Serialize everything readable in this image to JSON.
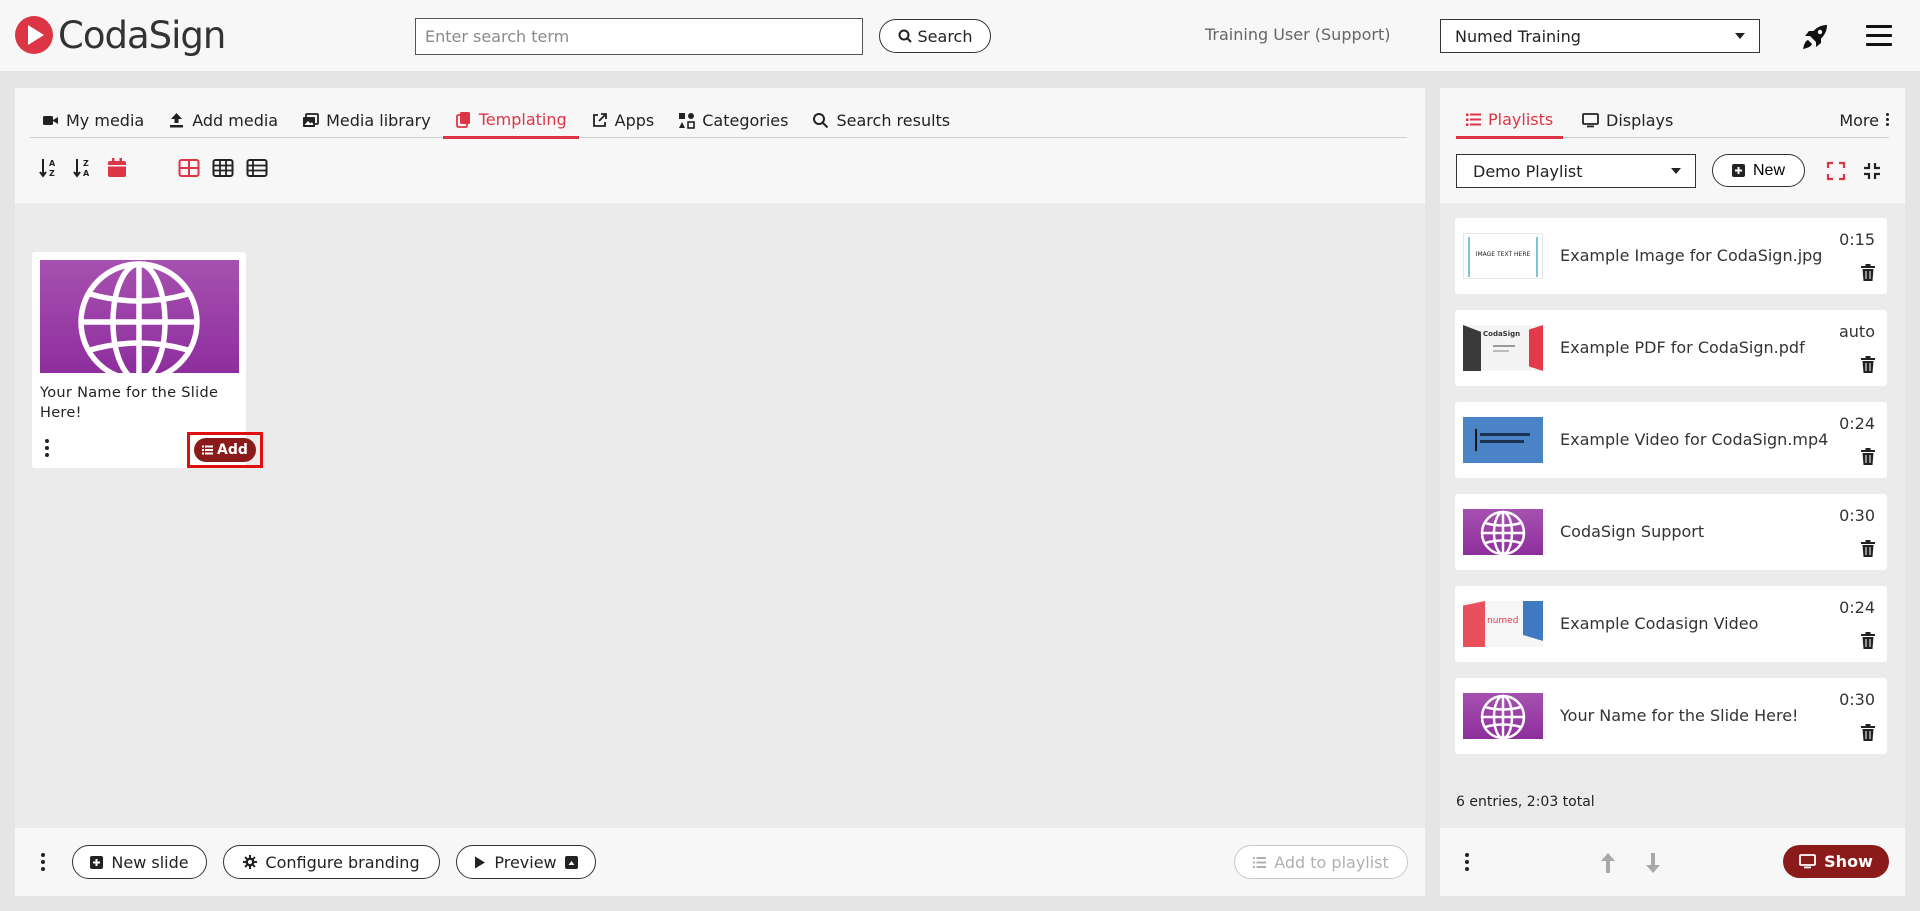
{
  "brand": {
    "name": "CodaSign",
    "accent": "#dc3545",
    "dark_red": "#8b1a1a"
  },
  "header": {
    "search_placeholder": "Enter search term",
    "search_value": "",
    "search_button": "Search",
    "user": "Training User (Support)",
    "organisation": "Numed Training"
  },
  "media_tabs": [
    {
      "label": "My media",
      "icon": "video-camera-icon",
      "active": false
    },
    {
      "label": "Add media",
      "icon": "upload-icon",
      "active": false
    },
    {
      "label": "Media library",
      "icon": "images-icon",
      "active": false
    },
    {
      "label": "Templating",
      "icon": "copy-icon",
      "active": true
    },
    {
      "label": "Apps",
      "icon": "external-link-icon",
      "active": false
    },
    {
      "label": "Categories",
      "icon": "categories-icon",
      "active": false
    },
    {
      "label": "Search results",
      "icon": "search-icon",
      "active": false
    }
  ],
  "toolbar": {
    "sort": [
      "sort-alpha-asc-icon",
      "sort-alpha-desc-icon",
      "calendar-icon"
    ],
    "views": [
      "large-grid-icon",
      "small-grid-icon",
      "list-view-icon"
    ]
  },
  "templates": [
    {
      "title": "Your Name for the Slide Here!",
      "thumbnail": "globe-icon",
      "add_label": "Add"
    }
  ],
  "left_footer": {
    "new_slide": "New slide",
    "configure_branding": "Configure branding",
    "preview": "Preview",
    "add_to_playlist": "Add to playlist"
  },
  "playlist_tabs": [
    {
      "label": "Playlists",
      "icon": "list-icon",
      "active": true
    },
    {
      "label": "Displays",
      "icon": "monitor-icon",
      "active": false
    }
  ],
  "playlist_more": "More",
  "playlist_select": "Demo Playlist",
  "playlist_new": "New",
  "playlist_items": [
    {
      "name": "Example Image for CodaSign.jpg",
      "duration": "0:15",
      "thumb": "image-text-thumb",
      "thumb_text": "IMAGE TEXT HERE"
    },
    {
      "name": "Example PDF for CodaSign.pdf",
      "duration": "auto",
      "thumb": "pdf-thumb",
      "thumb_text": "CodaSign"
    },
    {
      "name": "Example Video for CodaSign.mp4",
      "duration": "0:24",
      "thumb": "video-thumb",
      "thumb_text": ""
    },
    {
      "name": "CodaSign Support",
      "duration": "0:30",
      "thumb": "globe-icon",
      "thumb_text": ""
    },
    {
      "name": "Example Codasign Video",
      "duration": "0:24",
      "thumb": "numed-thumb",
      "thumb_text": "numed"
    },
    {
      "name": "Your Name for the Slide Here!",
      "duration": "0:30",
      "thumb": "globe-icon",
      "thumb_text": ""
    }
  ],
  "playlist_summary": "6 entries, 2:03 total",
  "right_footer": {
    "show": "Show"
  }
}
